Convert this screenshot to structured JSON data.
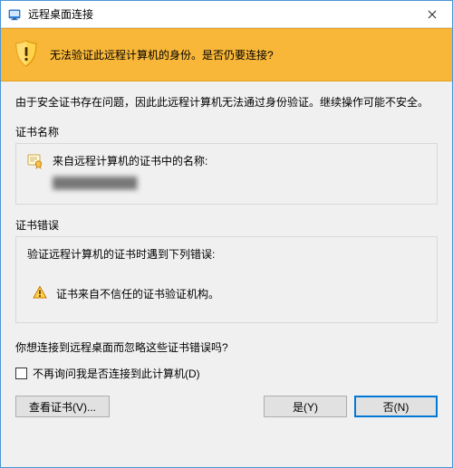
{
  "titlebar": {
    "title": "远程桌面连接"
  },
  "banner": {
    "text": "无法验证此远程计算机的身份。是否仍要连接?"
  },
  "body": {
    "description": "由于安全证书存在问题，因此此远程计算机无法通过身份验证。继续操作可能不安全。",
    "cert_name_section": "证书名称",
    "cert_name_label": "来自远程计算机的证书中的名称:",
    "cert_name_value": "███████████",
    "cert_error_section": "证书错误",
    "cert_error_desc": "验证远程计算机的证书时遇到下列错误:",
    "cert_error_item": "证书来自不信任的证书验证机构。",
    "question": "你想连接到远程桌面而忽略这些证书错误吗?",
    "checkbox_label": "不再询问我是否连接到此计算机(D)"
  },
  "buttons": {
    "view_cert": "查看证书(V)...",
    "yes": "是(Y)",
    "no": "否(N)"
  }
}
